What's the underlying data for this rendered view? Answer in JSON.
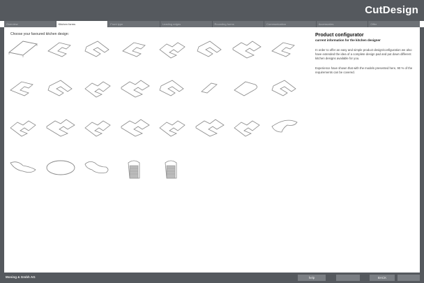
{
  "app": {
    "brand": "CutDesign"
  },
  "tabs": [
    {
      "label": "Overview",
      "active": false
    },
    {
      "label": "Kitchen forms",
      "active": true
    },
    {
      "label": "Front type",
      "active": false
    },
    {
      "label": "Leading edges",
      "active": false
    },
    {
      "label": "Rounding forms",
      "active": false
    },
    {
      "label": "Communication",
      "active": false
    },
    {
      "label": "Accessories",
      "active": false
    },
    {
      "label": "Offer",
      "active": false
    }
  ],
  "main": {
    "title": "Choose your favoured kitchen design:",
    "designs": [
      {
        "shape": "straight"
      },
      {
        "shape": "l-left"
      },
      {
        "shape": "l-right"
      },
      {
        "shape": "l-left"
      },
      {
        "shape": "u"
      },
      {
        "shape": "l-right"
      },
      {
        "shape": "u-wide"
      },
      {
        "shape": "l-left"
      },
      {
        "shape": "l-left"
      },
      {
        "shape": "l-right"
      },
      {
        "shape": "u"
      },
      {
        "shape": "u-wide"
      },
      {
        "shape": "l-right"
      },
      {
        "shape": "small-block"
      },
      {
        "shape": "island-curve"
      },
      {
        "shape": "l-right"
      },
      {
        "shape": "u"
      },
      {
        "shape": "u-wide"
      },
      {
        "shape": "u"
      },
      {
        "shape": "u-wide"
      },
      {
        "shape": "u"
      },
      {
        "shape": "u-wide"
      },
      {
        "shape": "u"
      },
      {
        "shape": "curve-top"
      },
      {
        "shape": "curve-left"
      },
      {
        "shape": "ellipse"
      },
      {
        "shape": "curve-right"
      },
      {
        "shape": "block-round"
      },
      {
        "shape": "block-round"
      }
    ]
  },
  "info": {
    "title": "Product configurator",
    "subtitle": "current information for the kitchen designer",
    "paragraph1": "In order to offer an easy and simple product design/configuration we also have extended the idea of a complete design pad and put down different kitchen designs available for you.",
    "paragraph2": "Experience have shown that with the models presented here, 90 % of the requirements can be covered."
  },
  "footer": {
    "company": "Moning & Gmbh AG",
    "help_label": "help",
    "back_label": "BACK",
    "blank1": "",
    "blank2": ""
  },
  "colors": {
    "chrome": "#55595e",
    "tab": "#6d7176",
    "button": "#7a7e83",
    "stroke": "#888888"
  }
}
